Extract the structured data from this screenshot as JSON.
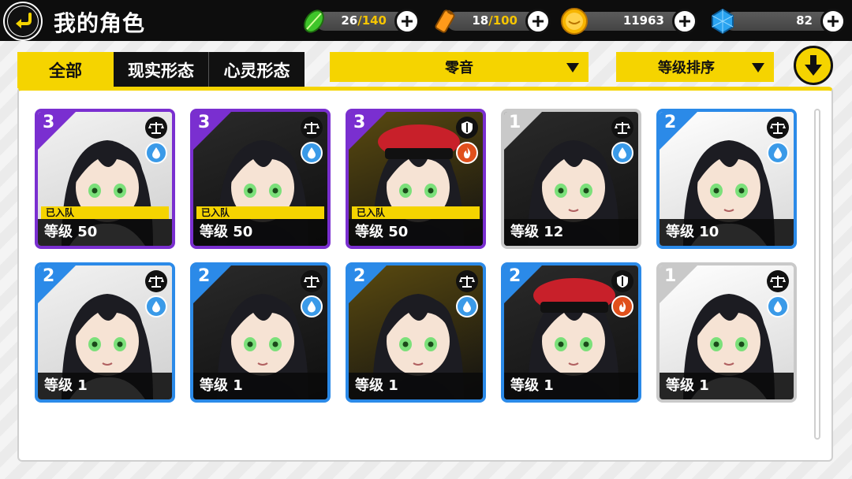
{
  "header": {
    "title": "我的角色",
    "stamina": {
      "value": "26",
      "sep": "/",
      "cap": "140"
    },
    "energy": {
      "value": "18",
      "sep": "/",
      "cap": "100"
    },
    "coins": {
      "value": "11963"
    },
    "gems": {
      "value": "82"
    }
  },
  "tabs": [
    {
      "label": "全部",
      "active": true
    },
    {
      "label": "现实形态",
      "active": false
    },
    {
      "label": "心灵形态",
      "active": false
    }
  ],
  "filter": {
    "selected": "零音"
  },
  "sort": {
    "selected": "等级排序"
  },
  "colors": {
    "accent": "#f5d400",
    "rank3": "#7a2fd0",
    "rank2": "#2b8ae8",
    "rank1": "#c9c9c9"
  },
  "cards": [
    {
      "rank": "3",
      "type": "balance-icon",
      "element": "water",
      "team": "已入队",
      "level": "等级 50"
    },
    {
      "rank": "3",
      "type": "balance-icon",
      "element": "water",
      "team": "已入队",
      "level": "等级 50"
    },
    {
      "rank": "3",
      "type": "shield-icon",
      "element": "fire",
      "team": "已入队",
      "level": "等级 50"
    },
    {
      "rank": "1",
      "type": "balance-icon",
      "element": "water",
      "team": "",
      "level": "等级 12"
    },
    {
      "rank": "2",
      "type": "balance-icon",
      "element": "water",
      "team": "",
      "level": "等级 10"
    },
    {
      "rank": "2",
      "type": "balance-icon",
      "element": "water",
      "team": "",
      "level": "等级 1"
    },
    {
      "rank": "2",
      "type": "balance-icon",
      "element": "water",
      "team": "",
      "level": "等级 1"
    },
    {
      "rank": "2",
      "type": "balance-icon",
      "element": "water",
      "team": "",
      "level": "等级 1"
    },
    {
      "rank": "2",
      "type": "shield-icon",
      "element": "fire",
      "team": "",
      "level": "等级 1"
    },
    {
      "rank": "1",
      "type": "balance-icon",
      "element": "water",
      "team": "",
      "level": "等级 1"
    }
  ]
}
